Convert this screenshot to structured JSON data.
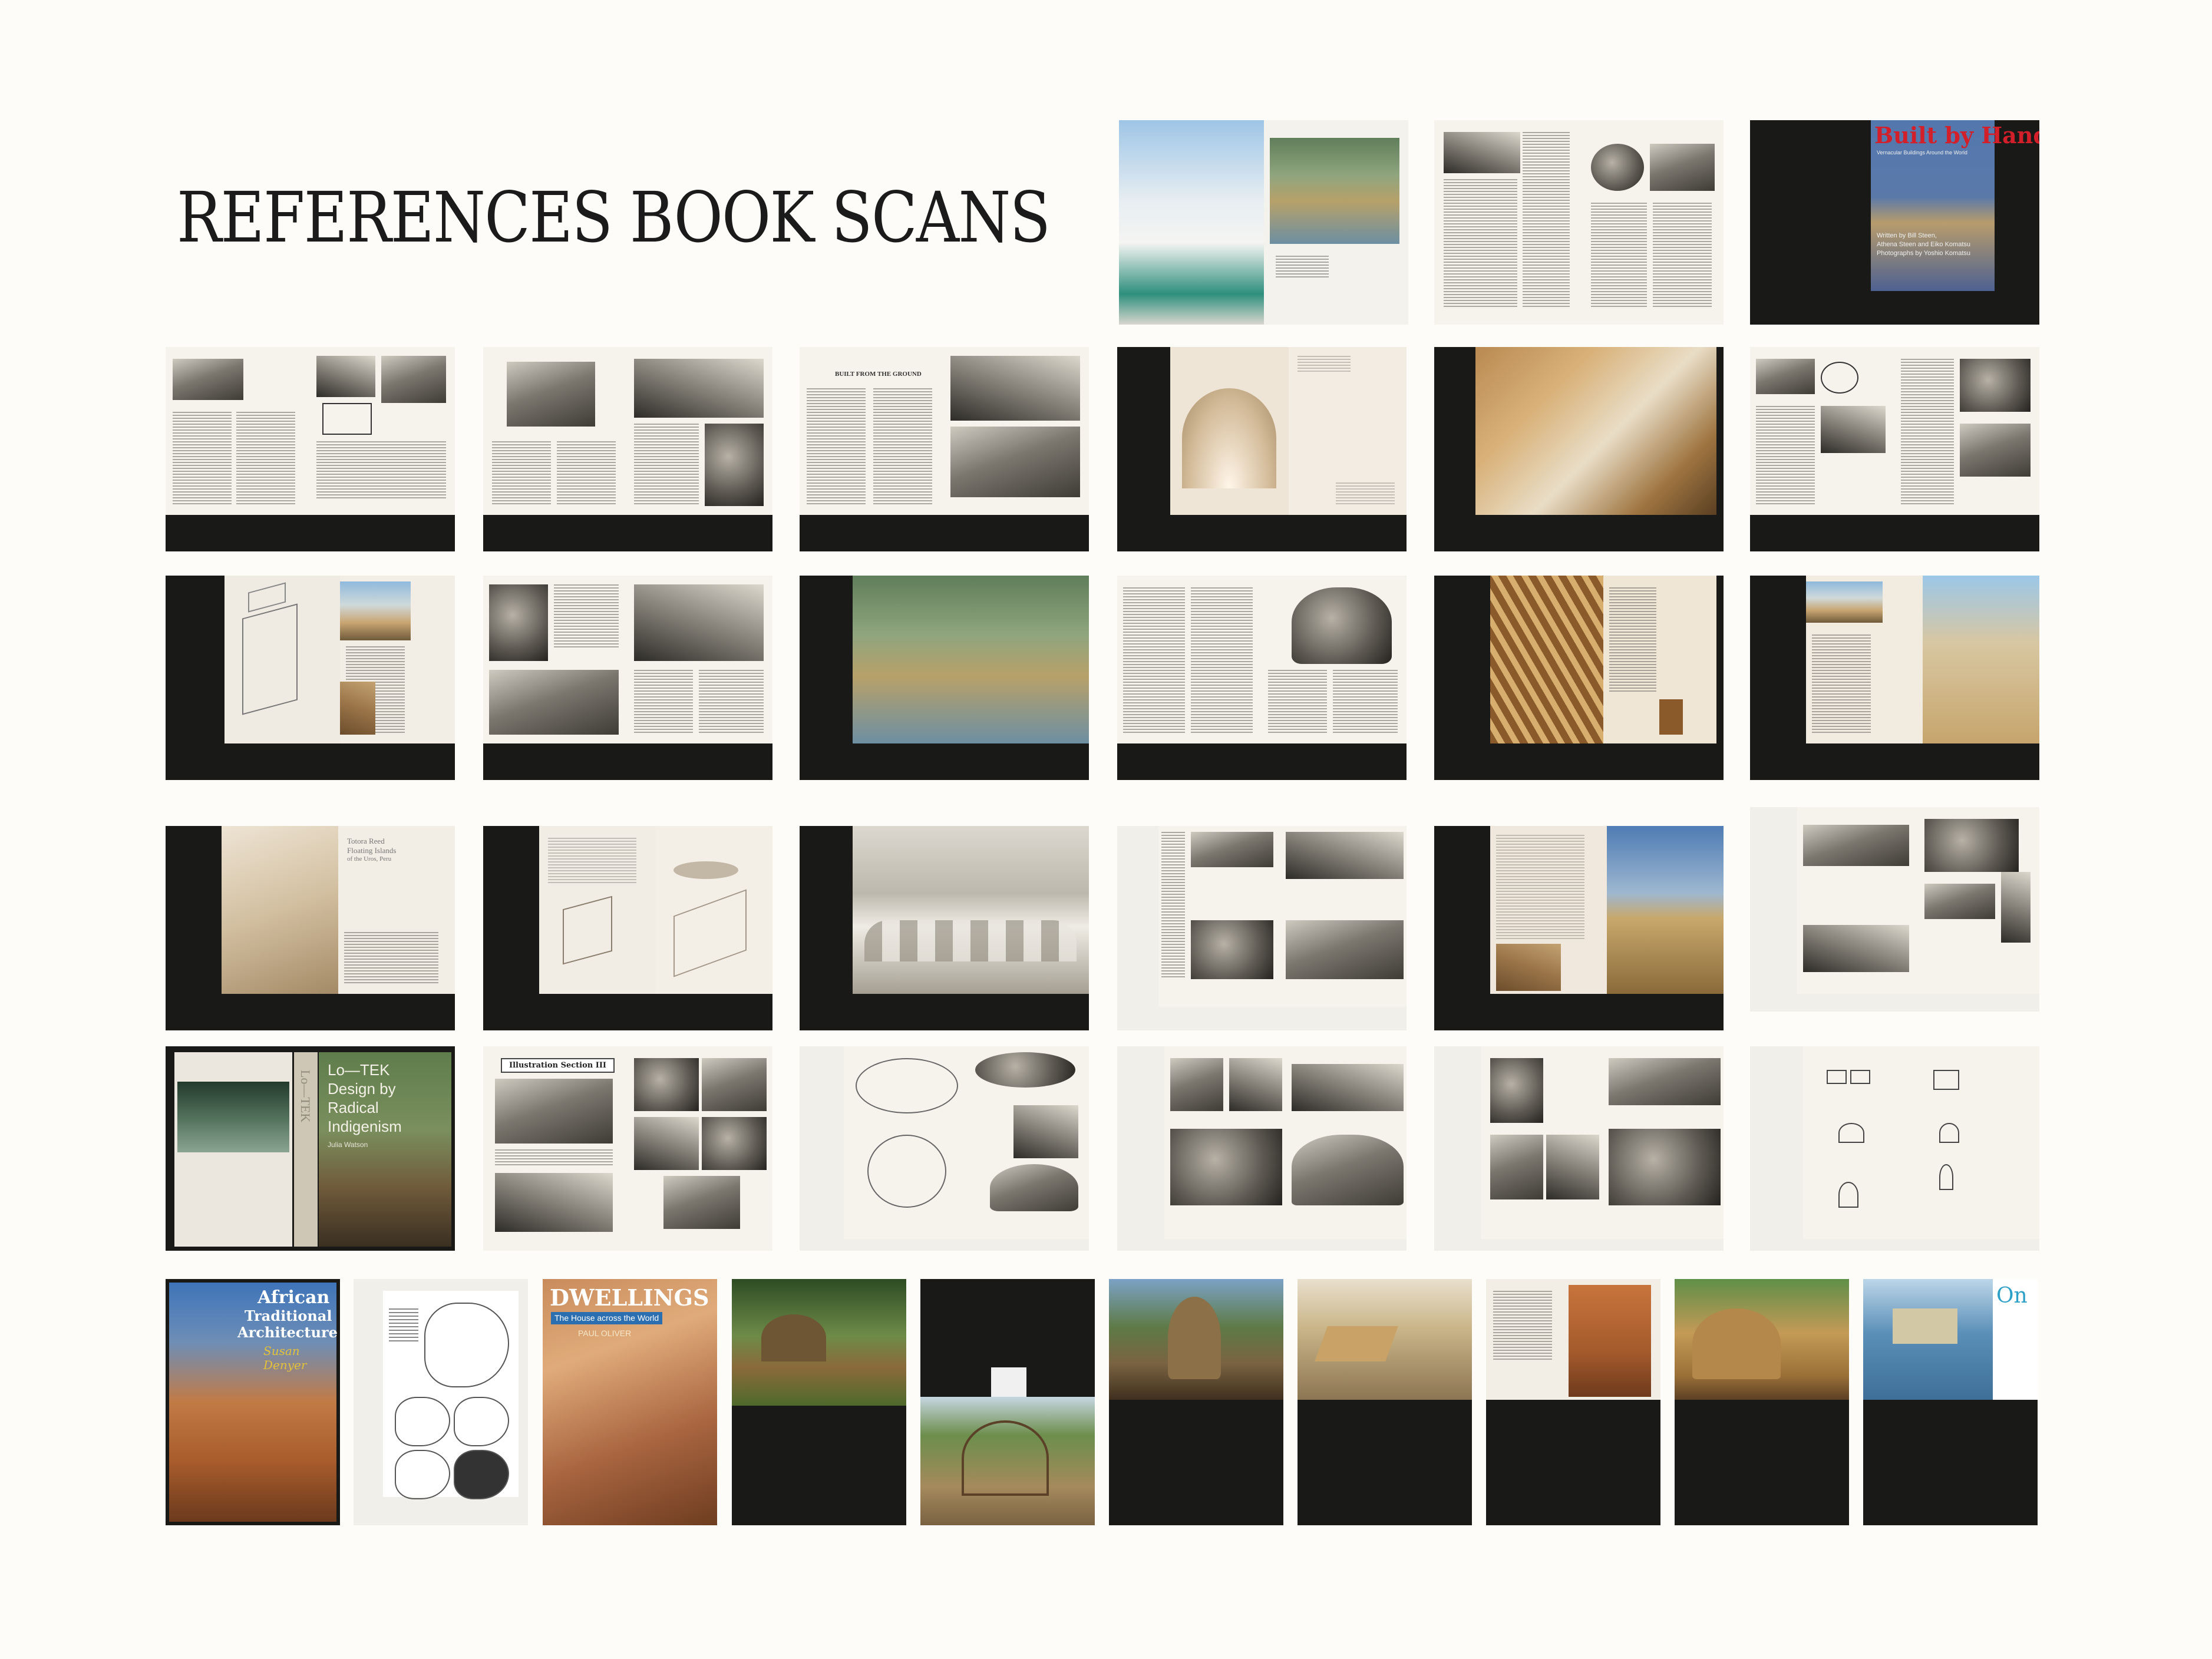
{
  "page": {
    "title": "REFERENCES BOOK SCANS"
  },
  "scans": [
    {
      "name": "scan-white-village-mosque",
      "kind": "color photo spread"
    },
    {
      "name": "scan-dome-structure-text",
      "kind": "text spread"
    },
    {
      "name": "cover-built-by-hand",
      "kind": "book cover",
      "cover": {
        "title": "Built by Hand",
        "subtitle": "Vernacular Buildings Around the World",
        "credits": [
          "Written by Bill Steen,",
          "Athena Steen and Eiko Komatsu",
          "Photographs by Yoshio Komatsu"
        ]
      }
    },
    {
      "name": "scan-hut-plans-spread",
      "kind": "text and drawings spread"
    },
    {
      "name": "scan-reed-village-bw",
      "kind": "bw photo spread"
    },
    {
      "name": "scan-built-from-the-ground",
      "kind": "bw photo spread",
      "heading": "BUILT FROM THE GROUND"
    },
    {
      "name": "scan-reed-arch-interior",
      "kind": "interior spread"
    },
    {
      "name": "scan-reed-builders-color",
      "kind": "color photo spread"
    },
    {
      "name": "scan-huts-and-plans",
      "kind": "text and drawings spread"
    },
    {
      "name": "scan-reed-house-axonometric",
      "kind": "drawing spread"
    },
    {
      "name": "scan-thatched-huts-bw",
      "kind": "bw photo spread"
    },
    {
      "name": "scan-marsh-reed-houses",
      "kind": "color photo spread"
    },
    {
      "name": "scan-reed-dome-text",
      "kind": "text spread"
    },
    {
      "name": "scan-reed-arches-interior",
      "kind": "color photo spread"
    },
    {
      "name": "scan-uros-reed-island",
      "kind": "color photo spread"
    },
    {
      "name": "scan-totora-reed-islands",
      "kind": "sepia spread",
      "heading": [
        "Totora Reed",
        "Floating Islands",
        "of the Uros, Peru"
      ]
    },
    {
      "name": "scan-reed-island-diagrams",
      "kind": "diagram spread"
    },
    {
      "name": "scan-reed-village-sketch",
      "kind": "sketch spread"
    },
    {
      "name": "scan-african-round-huts",
      "kind": "bw photo spread"
    },
    {
      "name": "scan-reed-towers-color",
      "kind": "color photo spread"
    },
    {
      "name": "scan-thatched-huts-catalog",
      "kind": "bw photo spread"
    },
    {
      "name": "cover-lo-tek",
      "kind": "book cover",
      "cover": {
        "title_lines": [
          "Lo—TEK",
          "Design by",
          "Radical",
          "Indigenism"
        ],
        "author": "Julia Watson",
        "spine": "Lo—TEK"
      }
    },
    {
      "name": "scan-illustration-section-iii",
      "kind": "bw photo spread",
      "heading": "Illustration Section III"
    },
    {
      "name": "scan-settlement-diagrams",
      "kind": "drawing spread"
    },
    {
      "name": "scan-grass-dome-huts",
      "kind": "bw photo spread"
    },
    {
      "name": "scan-round-hut-photos",
      "kind": "bw photo spread"
    },
    {
      "name": "scan-hut-section-diagrams",
      "kind": "diagram spread"
    },
    {
      "name": "cover-african-traditional-architecture",
      "kind": "book cover",
      "cover": {
        "title_lines": [
          "African",
          "Traditional",
          "Architecture"
        ],
        "author": "Susan Denyer"
      }
    },
    {
      "name": "scan-africa-maps",
      "kind": "map page"
    },
    {
      "name": "cover-dwellings",
      "kind": "book cover",
      "cover": {
        "title": "DWELLINGS",
        "subtitle": "The House across the World",
        "author": "PAUL OLIVER"
      }
    },
    {
      "name": "scan-hut-in-forest",
      "kind": "color photo page"
    },
    {
      "name": "scan-dome-frame-construction",
      "kind": "color photo page"
    },
    {
      "name": "scan-tall-thatched-hut",
      "kind": "color photo page"
    },
    {
      "name": "scan-reed-boats",
      "kind": "color photo page"
    },
    {
      "name": "scan-reed-bundle-weaving",
      "kind": "color photo page"
    },
    {
      "name": "scan-thatch-roof-builders",
      "kind": "color photo page"
    },
    {
      "name": "scan-stilt-house",
      "kind": "color photo page",
      "heading": "On"
    }
  ]
}
